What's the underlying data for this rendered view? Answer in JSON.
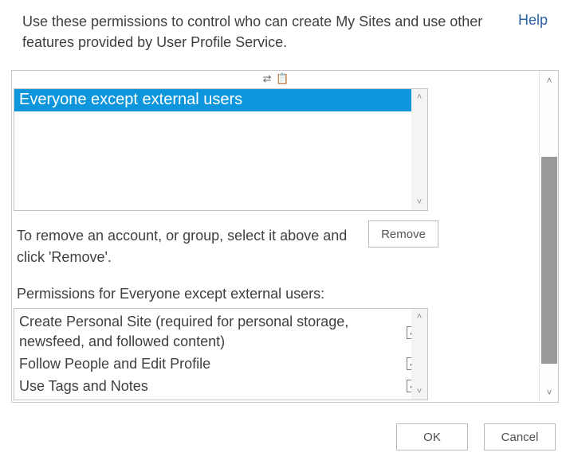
{
  "header": {
    "intro_text": "Use these permissions to control who can create My Sites and use other features provided by User Profile Service.",
    "help_label": "Help"
  },
  "accounts": {
    "selected_item": "Everyone except external users",
    "remove_button_label": "Remove",
    "remove_hint": "To remove an account, or group, select it above and click 'Remove'."
  },
  "permissions": {
    "label": "Permissions for Everyone except external users:",
    "items": [
      {
        "label": "Create Personal Site (required for personal storage, newsfeed, and followed content)",
        "checked": true
      },
      {
        "label": "Follow People and Edit Profile",
        "checked": true
      },
      {
        "label": "Use Tags and Notes",
        "checked": true
      }
    ]
  },
  "footer": {
    "ok_label": "OK",
    "cancel_label": "Cancel"
  },
  "decor": {
    "tiny_icons": "⇄ 📋"
  }
}
